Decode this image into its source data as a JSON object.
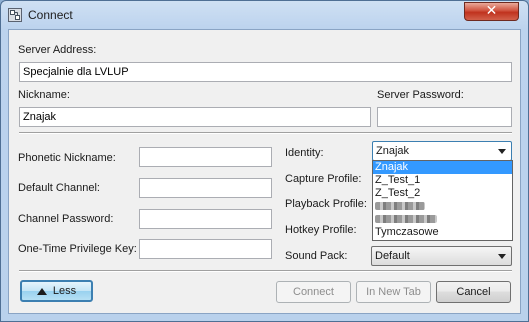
{
  "window": {
    "title": "Connect",
    "close_glyph": "✕"
  },
  "server_address": {
    "label": "Server Address:",
    "value": "Specjalnie dla LVLUP"
  },
  "nickname": {
    "label": "Nickname:",
    "value": "Znajak"
  },
  "server_password": {
    "label": "Server Password:",
    "value": ""
  },
  "phonetic_nickname": {
    "label": "Phonetic Nickname:",
    "value": ""
  },
  "default_channel": {
    "label": "Default Channel:",
    "value": ""
  },
  "channel_password": {
    "label": "Channel Password:",
    "value": ""
  },
  "privilege_key": {
    "label": "One-Time Privilege Key:",
    "value": ""
  },
  "identity": {
    "label": "Identity:",
    "selected": "Znajak",
    "options": [
      "Znajak",
      "Z_Test_1",
      "Z_Test_2",
      "[blurred]",
      "[blurred]",
      "Tymczasowe"
    ]
  },
  "capture_profile": {
    "label": "Capture Profile:"
  },
  "playback_profile": {
    "label": "Playback Profile:"
  },
  "hotkey_profile": {
    "label": "Hotkey Profile:"
  },
  "sound_pack": {
    "label": "Sound Pack:",
    "selected": "Default"
  },
  "buttons": {
    "less": "Less",
    "connect": "Connect",
    "new_tab": "In New Tab",
    "cancel": "Cancel"
  },
  "icons": {
    "app": "teamspeak-app-icon",
    "close": "close-icon",
    "less_arrow": "triangle-up-icon",
    "dropdown_arrow": "chevron-down-icon"
  }
}
